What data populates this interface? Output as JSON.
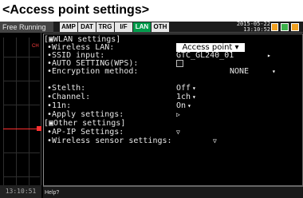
{
  "caption": "<Access point settings>",
  "topbar": {
    "status": "Free Running",
    "tabs": [
      "AMP",
      "DAT",
      "TRG",
      "I/F",
      "LAN",
      "OTH"
    ],
    "active_tab": "LAN",
    "date": "2015-05-22",
    "time": "13:10:52"
  },
  "wave": {
    "channel": "CH",
    "time": "13:10:51"
  },
  "menu": {
    "wlan_header": "[▣WLAN settings]",
    "wireless_lan_label": "•Wireless LAN:",
    "wireless_lan_value": "Access point ▾",
    "ssid_label": "•SSID input:",
    "ssid_value": "GTC_GL240_01",
    "auto_label": "•AUTO SETTING(WPS):",
    "encryption_label": "•Encryption method:",
    "encryption_value": "NONE",
    "stealth_label": "•Stelth:",
    "stealth_value": "Off",
    "channel_label": "•Channel:",
    "channel_value": "1ch",
    "n11_label": "•11n:",
    "n11_value": "On",
    "apply_label": "•Apply settings:",
    "other_header": "[▣Other settings]",
    "apip_label": "•AP-IP Settings:",
    "wireless_sensor_label": "•Wireless sensor settings:"
  },
  "help": "Help?"
}
